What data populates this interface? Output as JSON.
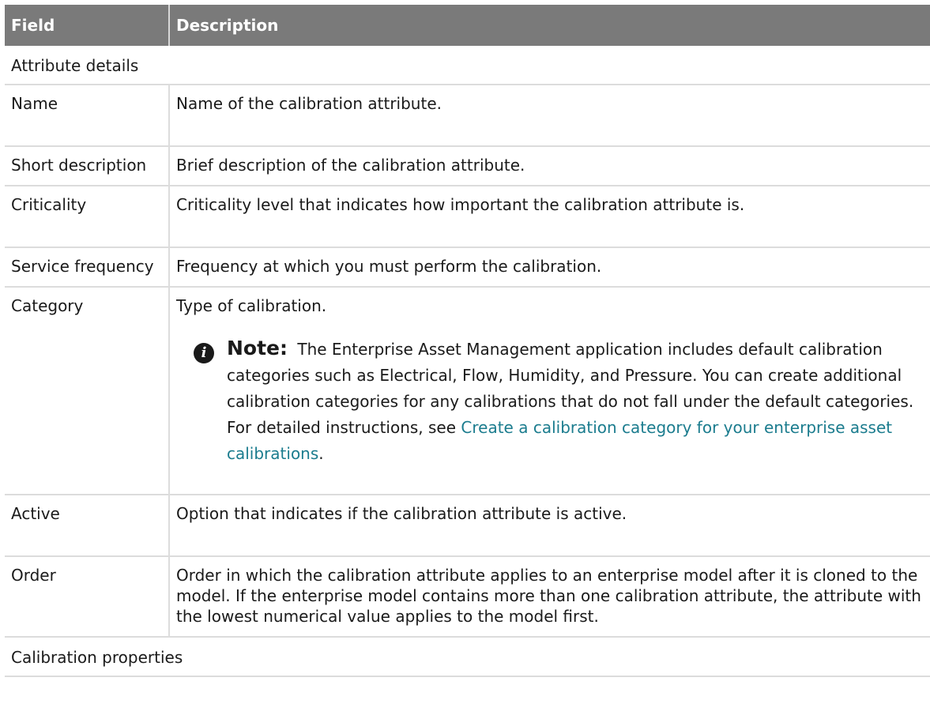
{
  "table": {
    "headers": {
      "field": "Field",
      "description": "Description"
    },
    "sections": {
      "attribute_details": "Attribute details",
      "calibration_properties": "Calibration properties"
    },
    "rows": [
      {
        "field": "Name",
        "description": "Name of the calibration attribute."
      },
      {
        "field": "Short description",
        "description": "Brief description of the calibration attribute."
      },
      {
        "field": "Criticality",
        "description": "Criticality level that indicates how important the calibration attribute is."
      },
      {
        "field": "Service frequency",
        "description": "Frequency at which you must perform the calibration."
      },
      {
        "field": "Category",
        "description": "Type of calibration.",
        "note": {
          "icon": "info-icon",
          "label": "Note:",
          "text": "The Enterprise Asset Management application includes default calibration categories such as Electrical, Flow, Humidity, and Pressure. You can create additional calibration categories for any calibrations that do not fall under the default categories. For detailed instructions, see",
          "link": "Create a calibration category for your enterprise asset calibrations",
          "trailing": "."
        }
      },
      {
        "field": "Active",
        "description": "Option that indicates if the calibration attribute is active."
      },
      {
        "field": "Order",
        "description": "Order in which the calibration attribute applies to an enterprise model after it is cloned to the model. If the enterprise model contains more than one calibration attribute, the attribute with the lowest numerical value applies to the model first."
      }
    ]
  }
}
